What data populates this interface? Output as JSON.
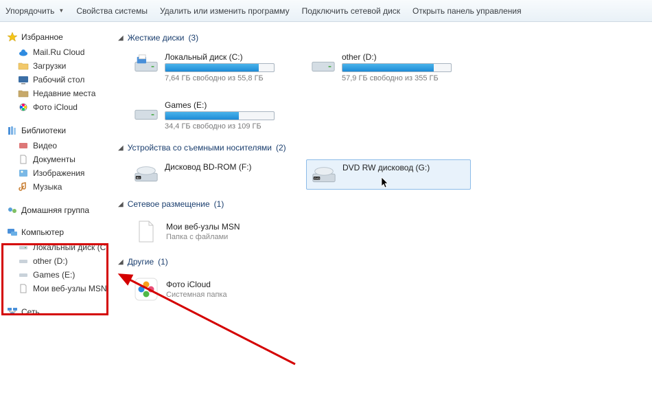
{
  "toolbar": {
    "organize": "Упорядочить",
    "system_props": "Свойства системы",
    "uninstall": "Удалить или изменить программу",
    "map_drive": "Подключить сетевой диск",
    "control_panel": "Открыть панель управления"
  },
  "sidebar": {
    "favorites": {
      "title": "Избранное"
    },
    "fav_items": {
      "mailru": "Mail.Ru Cloud",
      "downloads": "Загрузки",
      "desktop": "Рабочий стол",
      "recent": "Недавние места",
      "icloud": "Фото iCloud"
    },
    "libraries": {
      "title": "Библиотеки"
    },
    "lib_items": {
      "video": "Видео",
      "documents": "Документы",
      "pictures": "Изображения",
      "music": "Музыка"
    },
    "homegroup": "Домашняя группа",
    "computer": "Компьютер",
    "comp_items": {
      "local_c": "Локальный диск (C",
      "other_d": "other (D:)",
      "games_e": "Games (E:)",
      "msn": "Мои веб-узлы MSN"
    },
    "network": "Сеть"
  },
  "sections": {
    "hdd": {
      "title": "Жесткие диски",
      "count": "(3)"
    },
    "removable": {
      "title": "Устройства со съемными носителями",
      "count": "(2)"
    },
    "network": {
      "title": "Сетевое размещение",
      "count": "(1)"
    },
    "other": {
      "title": "Другие",
      "count": "(1)"
    }
  },
  "drives": {
    "c": {
      "name": "Локальный диск (C:)",
      "free": "7,64 ГБ свободно из 55,8 ГБ",
      "fill": 86
    },
    "d": {
      "name": "other (D:)",
      "free": "57,9 ГБ свободно из 355 ГБ",
      "fill": 84
    },
    "e": {
      "name": "Games (E:)",
      "free": "34,4 ГБ свободно из 109 ГБ",
      "fill": 68
    }
  },
  "optical": {
    "bd": {
      "name": "Дисковод BD-ROM (F:)"
    },
    "dvd": {
      "name": "DVD RW дисковод (G:)"
    }
  },
  "netloc": {
    "msn": {
      "name": "Мои веб-узлы MSN",
      "sub": "Папка с файлами"
    }
  },
  "other_items": {
    "icloud": {
      "name": "Фото iCloud",
      "sub": "Системная папка"
    }
  }
}
